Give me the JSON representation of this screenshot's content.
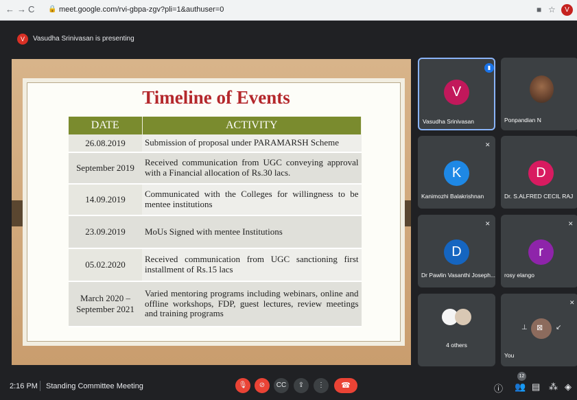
{
  "browser": {
    "url": "meet.google.com/rvi-gbpa-zgv?pli=1&authuser=0",
    "profile_initial": "V"
  },
  "presenting": {
    "badge": "V",
    "text": "Vasudha Srinivasan is presenting"
  },
  "slide": {
    "title": "Timeline of Events",
    "headers": [
      "DATE",
      "ACTIVITY"
    ],
    "rows": [
      {
        "date": "26.08.2019",
        "activity": "Submission of proposal under PARAMARSH Scheme"
      },
      {
        "date": "September 2019",
        "activity": "Received communication from UGC conveying approval with a Financial allocation of Rs.30 lacs."
      },
      {
        "date": "14.09.2019",
        "activity": "Communicated with the Colleges for willingness to be mentee institutions"
      },
      {
        "date": "23.09.2019",
        "activity": "MoUs Signed with mentee Institutions"
      },
      {
        "date": "05.02.2020",
        "activity": "Received communication from UGC sanctioning first installment of Rs.15 lacs"
      },
      {
        "date": "March 2020 – September 2021",
        "activity": "Varied mentoring programs including webinars, online and offline workshops, FDP, guest lectures, review meetings and training programs"
      }
    ]
  },
  "participants": [
    {
      "name": "Vasudha Srinivasan",
      "initial": "V",
      "color": "#c2185b"
    },
    {
      "name": "Ponpandian N",
      "initial": "",
      "color": "#5f6368"
    },
    {
      "name": "Kanimozhi Balakrishnan",
      "initial": "K",
      "color": "#1e88e5"
    },
    {
      "name": "Dr. S.ALFRED CECIL RAJ",
      "initial": "D",
      "color": "#d81b60"
    },
    {
      "name": "Dr Pawlin Vasanthi Joseph...",
      "initial": "D",
      "color": "#1565c0"
    },
    {
      "name": "rosy elango",
      "initial": "r",
      "color": "#8e24aa"
    },
    {
      "name": "4 others",
      "initial": "",
      "color": "#5f6368"
    },
    {
      "name": "You",
      "initial": "",
      "color": "#5f6368"
    }
  ],
  "bottom": {
    "time": "2:16 PM",
    "meeting_title": "Standing Committee Meeting",
    "participant_count": "12"
  },
  "colors": {
    "accent_red": "#ea4335",
    "tile_bg": "#3c4043",
    "header_green": "#7a8b2e",
    "title_red": "#b4282c"
  }
}
